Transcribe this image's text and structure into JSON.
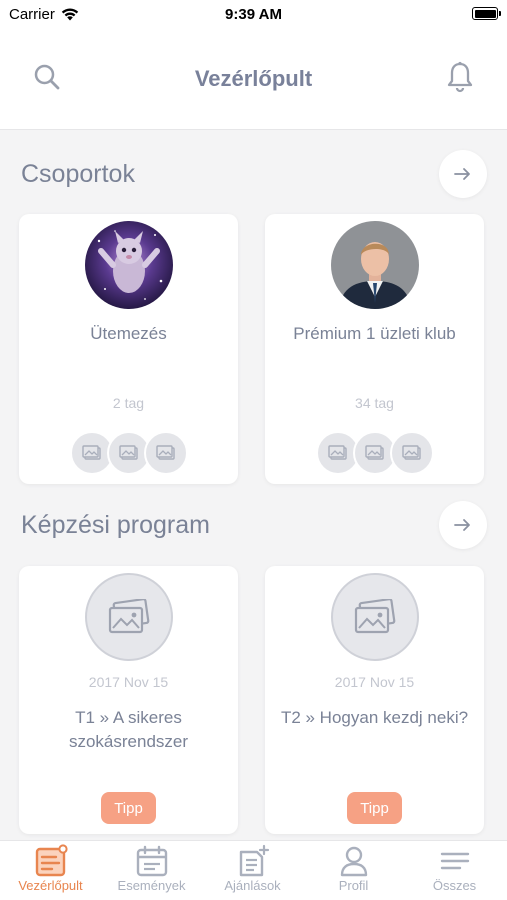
{
  "status_bar": {
    "carrier": "Carrier",
    "time": "9:39 AM"
  },
  "header": {
    "title": "Vezérlőpult",
    "search_icon": "search-icon",
    "bell_icon": "bell-icon"
  },
  "groups": {
    "title": "Csoportok",
    "cards": [
      {
        "name": "Ütemezés",
        "members": "2 tag"
      },
      {
        "name": "Prémium 1 üzleti klub",
        "members": "34 tag"
      }
    ]
  },
  "training": {
    "title": "Képzési program",
    "cards": [
      {
        "date": "2017 Nov 15",
        "title": "T1 » A sikeres szokásrendszer",
        "tag": "Tipp"
      },
      {
        "date": "2017 Nov 15",
        "title": "T2 » Hogyan kezdj neki?",
        "tag": "Tipp"
      }
    ]
  },
  "tabs": [
    {
      "label": "Vezérlőpult",
      "icon": "dashboard-icon",
      "active": true
    },
    {
      "label": "Események",
      "icon": "calendar-icon",
      "active": false
    },
    {
      "label": "Ajánlások",
      "icon": "recommendation-icon",
      "active": false
    },
    {
      "label": "Profil",
      "icon": "profile-icon",
      "active": false
    },
    {
      "label": "Összes",
      "icon": "menu-icon",
      "active": false
    }
  ],
  "colors": {
    "accent": "#e8854f",
    "tag": "#f6a184",
    "text": "#7a8296",
    "muted": "#c3c6cf"
  }
}
